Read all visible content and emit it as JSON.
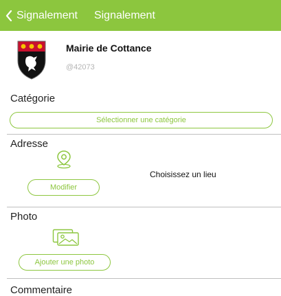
{
  "nav": {
    "back_label": "Signalement",
    "title": "Signalement"
  },
  "org": {
    "name": "Mairie de Cottance",
    "handle": "@42073"
  },
  "category": {
    "label": "Catégorie",
    "select_label": "Sélectionner une catégorie"
  },
  "address": {
    "label": "Adresse",
    "modify_label": "Modifier",
    "place_prompt": "Choisissez un lieu"
  },
  "photo": {
    "label": "Photo",
    "add_label": "Ajouter une photo"
  },
  "comment": {
    "label": "Commentaire"
  },
  "colors": {
    "accent": "#8cc63e",
    "crest_red": "#c8102e",
    "crest_yellow": "#f5c400",
    "crest_black": "#111111"
  },
  "icons": [
    "chevron-left-icon",
    "map-pin-icon",
    "photos-icon",
    "crest-logo"
  ]
}
